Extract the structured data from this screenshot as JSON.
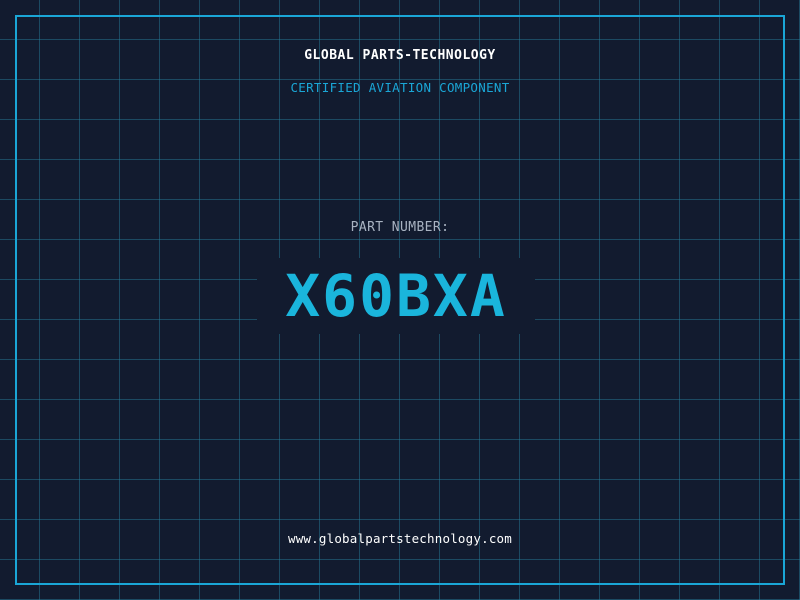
{
  "header": {
    "company": "GLOBAL PARTS-TECHNOLOGY",
    "subtitle": "CERTIFIED AVIATION COMPONENT"
  },
  "part": {
    "label": "PART NUMBER:",
    "number": "X60BXA"
  },
  "footer": {
    "url": "www.globalpartstechnology.com"
  },
  "colors": {
    "background": "#121b2f",
    "grid": "#2882a0",
    "accent": "#1aa6d6",
    "part_number": "#1ab5dc",
    "text_primary": "#ffffff",
    "text_muted": "#a9b3c2"
  }
}
